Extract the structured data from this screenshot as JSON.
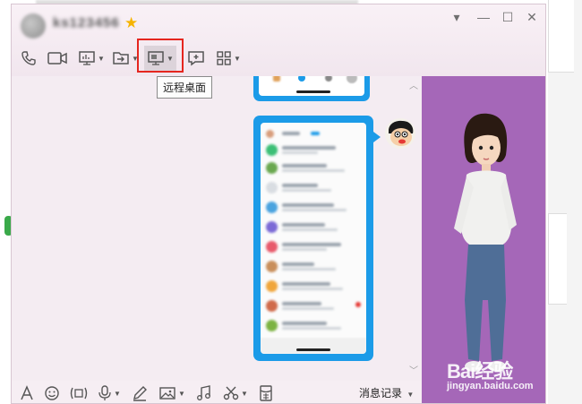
{
  "window": {
    "title_user": "ks123456",
    "controls": [
      "▾",
      "—",
      "☐",
      "✕"
    ]
  },
  "toolbar": {
    "tools": [
      {
        "name": "voice-call",
        "icon": "phone-icon",
        "has_dropdown": false
      },
      {
        "name": "video-call",
        "icon": "video-camera-icon",
        "has_dropdown": false
      },
      {
        "name": "screen-share",
        "icon": "presentation-icon",
        "has_dropdown": true
      },
      {
        "name": "send-file",
        "icon": "file-transfer-icon",
        "has_dropdown": true
      },
      {
        "name": "remote-desktop",
        "icon": "monitor-icon",
        "has_dropdown": true
      },
      {
        "name": "add-chat",
        "icon": "chat-plus-icon",
        "has_dropdown": false
      },
      {
        "name": "apps",
        "icon": "grid-icon",
        "has_dropdown": true
      }
    ],
    "tooltip": "远程桌面",
    "highlight_color": "#e5261f"
  },
  "chat": {
    "bubble_color": "#1b9be8"
  },
  "bottom_toolbar": {
    "tools": [
      "font-icon",
      "emoji-icon",
      "gif-icon",
      "microphone-icon",
      "pen-icon",
      "image-icon",
      "music-icon",
      "scissors-icon",
      "red-envelope-icon"
    ],
    "history_label": "消息记录"
  },
  "side_panel": {
    "background_color": "#a567b8"
  },
  "watermark": {
    "brand": "Bai",
    "suffix": "经验",
    "url": "jingyan.baidu.com"
  }
}
